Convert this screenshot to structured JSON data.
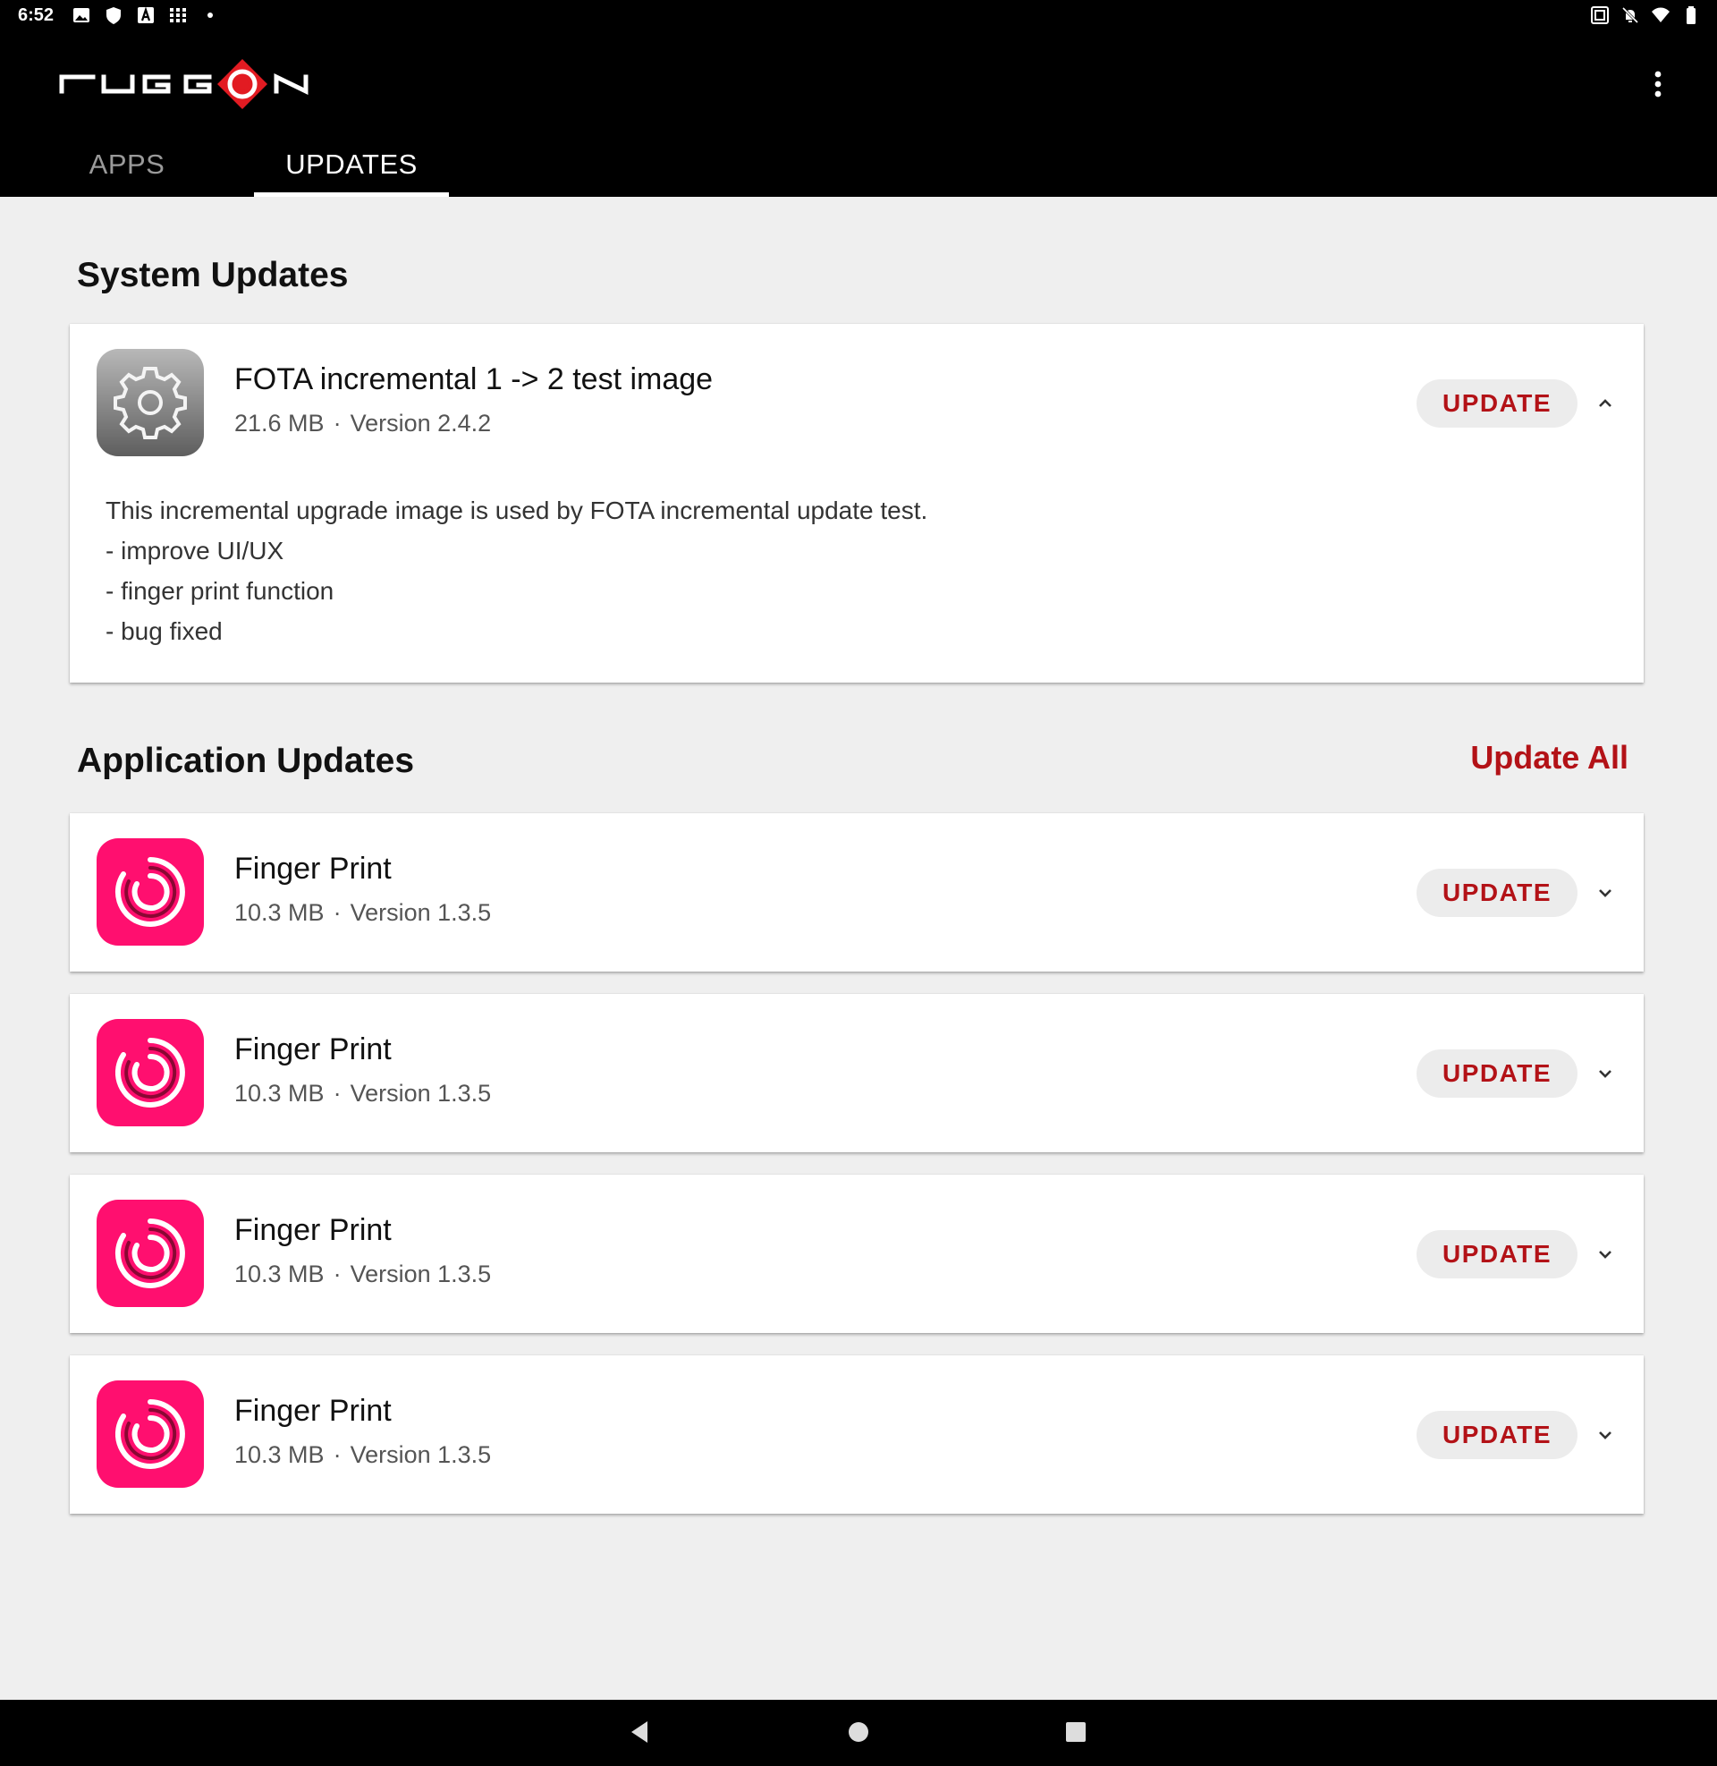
{
  "status_bar": {
    "time": "6:52",
    "left_icons": [
      "image-icon",
      "shield-icon",
      "a-box-icon",
      "grid-icon",
      "dot-icon"
    ],
    "right_icons": [
      "nfc-icon",
      "bell-off-icon",
      "wifi-icon",
      "battery-icon"
    ]
  },
  "app_bar": {
    "logo_text": "RUGGON",
    "tabs": [
      {
        "label": "APPS",
        "selected": false
      },
      {
        "label": "UPDATES",
        "selected": true
      }
    ]
  },
  "system_updates": {
    "title": "System Updates",
    "items": [
      {
        "name": "FOTA incremental 1 -> 2 test image",
        "size": "21.6 MB",
        "separator": "·",
        "version": "Version 2.4.2",
        "button_label": "UPDATE",
        "expanded": true,
        "description": [
          "This incremental upgrade image is used by FOTA incremental update test.",
          "- improve UI/UX",
          "- finger print function",
          "- bug fixed"
        ]
      }
    ]
  },
  "application_updates": {
    "title": "Application Updates",
    "update_all_label": "Update All",
    "items": [
      {
        "name": "Finger Print",
        "size": "10.3 MB",
        "separator": "·",
        "version": "Version 1.3.5",
        "button_label": "UPDATE",
        "expanded": false
      },
      {
        "name": "Finger Print",
        "size": "10.3 MB",
        "separator": "·",
        "version": "Version 1.3.5",
        "button_label": "UPDATE",
        "expanded": false
      },
      {
        "name": "Finger Print",
        "size": "10.3 MB",
        "separator": "·",
        "version": "Version 1.3.5",
        "button_label": "UPDATE",
        "expanded": false
      },
      {
        "name": "Finger Print",
        "size": "10.3 MB",
        "separator": "·",
        "version": "Version 1.3.5",
        "button_label": "UPDATE",
        "expanded": false
      }
    ]
  },
  "colors": {
    "accent_red": "#b31217",
    "fingerprint_icon_bg": "#ff0f6f",
    "header_bg": "#000000",
    "page_bg": "#efefef"
  },
  "nav_bar": {
    "buttons": [
      "back-icon",
      "home-icon",
      "recents-icon"
    ]
  }
}
